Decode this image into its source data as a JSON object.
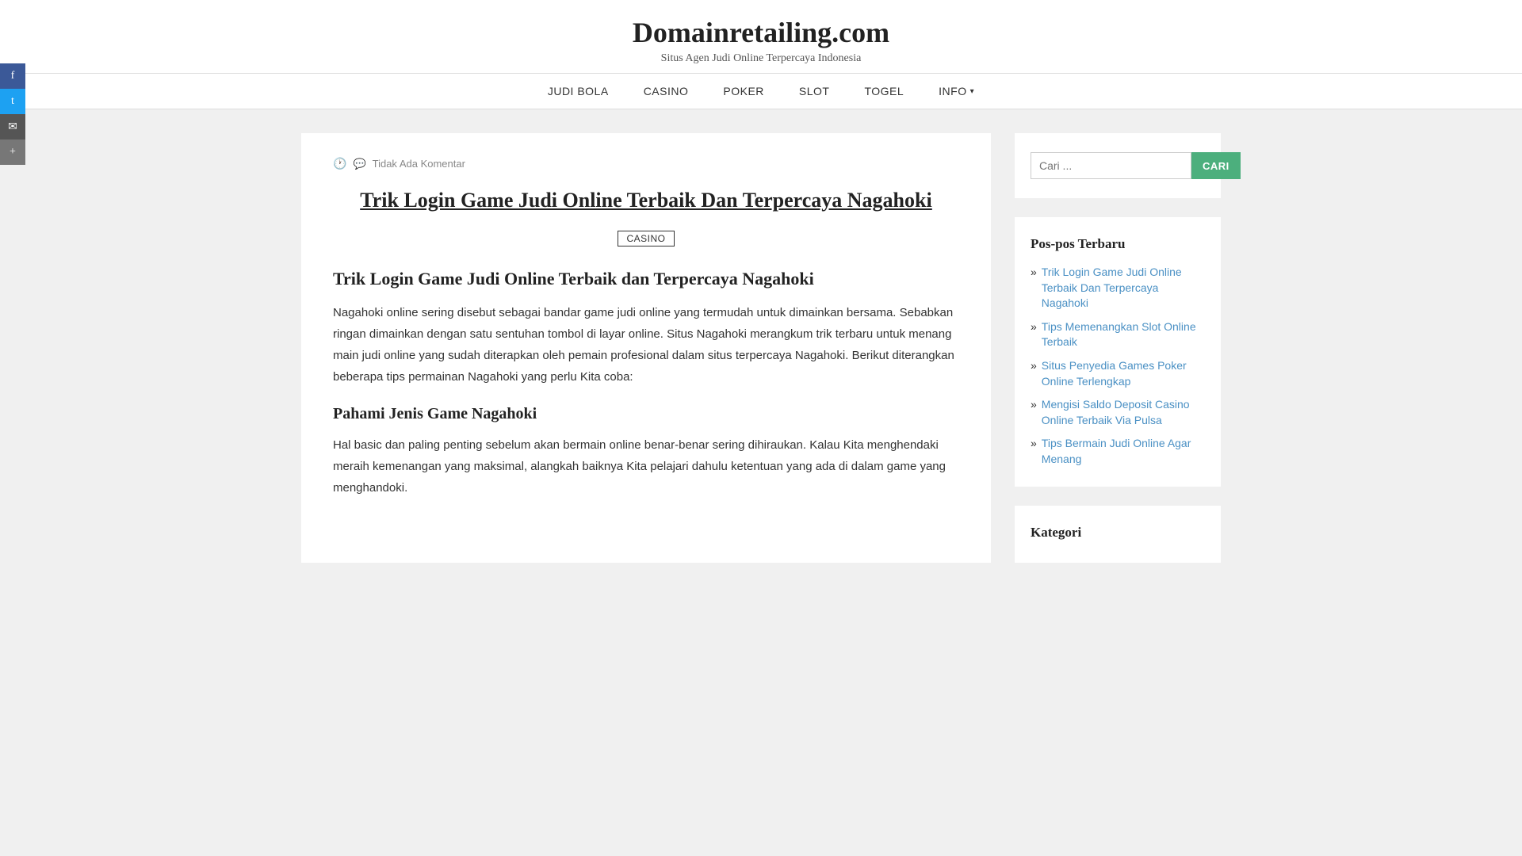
{
  "site": {
    "title": "Domainretailing.com",
    "tagline": "Situs Agen Judi Online Terpercaya Indonesia"
  },
  "nav": {
    "items": [
      {
        "label": "JUDI BOLA",
        "hasDropdown": false
      },
      {
        "label": "CASINO",
        "hasDropdown": false
      },
      {
        "label": "POKER",
        "hasDropdown": false
      },
      {
        "label": "SLOT",
        "hasDropdown": false
      },
      {
        "label": "TOGEL",
        "hasDropdown": false
      },
      {
        "label": "INFO",
        "hasDropdown": true
      }
    ]
  },
  "social": {
    "facebook": "f",
    "twitter": "t",
    "email": "✉",
    "share": "+"
  },
  "post": {
    "meta_comment": "Tidak Ada Komentar",
    "title": "Trik Login Game Judi Online Terbaik Dan Terpercaya Nagahoki",
    "category": "CASINO",
    "heading1": "Trik Login Game Judi Online Terbaik dan Terpercaya Nagahoki",
    "body1": "Nagahoki online sering disebut sebagai bandar game judi online yang termudah untuk dimainkan bersama. Sebabkan ringan dimainkan dengan satu sentuhan tombol di layar online. Situs Nagahoki merangkum trik terbaru untuk menang main judi online yang sudah diterapkan oleh pemain profesional dalam situs terpercaya Nagahoki. Berikut diterangkan beberapa tips permainan Nagahoki yang perlu Kita coba:",
    "heading2": "Pahami Jenis Game Nagahoki",
    "body2": "Hal basic dan paling penting sebelum akan bermain online benar-benar sering dihiraukan. Kalau Kita menghendaki meraih kemenangan yang maksimal, alangkah baiknya Kita pelajari dahulu ketentuan yang ada di dalam game yang menghandoki."
  },
  "sidebar": {
    "search": {
      "placeholder": "Cari ...",
      "button_label": "CARI"
    },
    "recent_posts": {
      "title": "Pos-pos Terbaru",
      "items": [
        "Trik Login Game Judi Online Terbaik Dan Terpercaya Nagahoki",
        "Tips Memenangkan Slot Online Terbaik",
        "Situs Penyedia Games Poker Online Terlengkap",
        "Mengisi Saldo Deposit Casino Online Terbaik Via Pulsa",
        "Tips Bermain Judi Online Agar Menang"
      ]
    },
    "kategori": {
      "title": "Kategori"
    }
  }
}
